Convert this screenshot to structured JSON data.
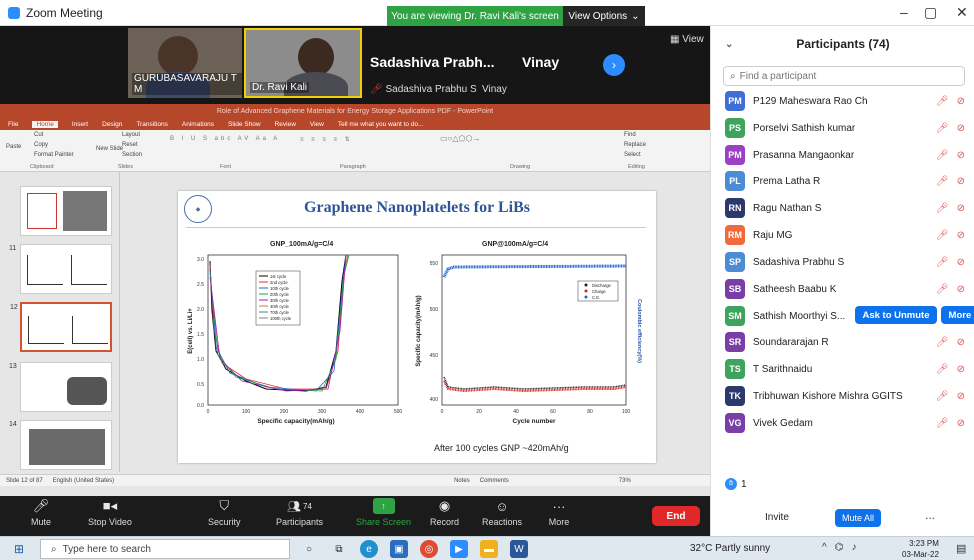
{
  "window": {
    "title": "Zoom Meeting"
  },
  "banner": {
    "viewing": "You are viewing Dr. Ravi Kali's screen",
    "view_options": "View Options"
  },
  "gallery": {
    "tiles": [
      {
        "name": "GURUBASAVARAJU T M"
      },
      {
        "name": "Dr. Ravi Kali"
      }
    ],
    "speaker_name": "Sadashiva  Prabh...",
    "speaker_sub": "Sadashiva Prabhu S",
    "second_name": "Vinay",
    "second_sub": "Vinay",
    "view_label": "View"
  },
  "ppt": {
    "title": "Role of Advanced Graphene Materials for Energy Storage Applications PDF - PowerPoint",
    "tabs": [
      "File",
      "Home",
      "Insert",
      "Design",
      "Transitions",
      "Animations",
      "Slide Show",
      "Review",
      "View",
      "Tell me what you want to do..."
    ],
    "ribbon_groups": [
      "Clipboard",
      "Slides",
      "Font",
      "Paragraph",
      "Drawing",
      "Editing"
    ],
    "clipboard": {
      "cut": "Cut",
      "copy": "Copy",
      "painter": "Format Painter",
      "paste": "Paste"
    },
    "slides": {
      "layout": "Layout",
      "reset": "Reset",
      "section": "Section",
      "new": "New Slide"
    },
    "editing": {
      "find": "Find",
      "replace": "Replace",
      "select": "Select"
    },
    "thumb_numbers": [
      "11",
      "12",
      "13",
      "14"
    ],
    "status": {
      "slide": "Slide 12 of 87",
      "lang": "English (United States)",
      "notes": "Notes",
      "comments": "Comments",
      "zoom": "73%"
    }
  },
  "slide": {
    "title": "Graphene Nanoplatelets for LiBs",
    "left_plot": {
      "title": "GNP_100mA/g=C/4",
      "xlabel": "Specific capacity(mAh/g)",
      "ylabel": "E(cell) vs. Li/Li+",
      "legend": [
        "1st cycle",
        "2nd cycle",
        "10th cycle",
        "20th cycle",
        "30th cycle",
        "40th cycle",
        "70th cycle",
        "100th cycle"
      ],
      "xticks": [
        "0",
        "100",
        "200",
        "300",
        "400",
        "500"
      ],
      "yticks": [
        "3.0",
        "2.5",
        "2.0",
        "1.5",
        "1.0",
        "0.5",
        "0.0"
      ]
    },
    "right_plot": {
      "title": "GNP@100mA/g=C/4",
      "xlabel": "Cycle number",
      "ylabel": "Specific capacity(mAh/g)",
      "ylabel2": "Coulombic efficiency(%)",
      "legend": [
        "Discharge",
        "Charge",
        "C.E."
      ],
      "xticks": [
        "0",
        "20",
        "40",
        "60",
        "80",
        "100"
      ],
      "yticks": [
        "550",
        "500",
        "450",
        "400"
      ]
    },
    "note": "After 100 cycles GNP ~420mAh/g"
  },
  "toolbar": {
    "mute": "Mute",
    "video": "Stop Video",
    "security": "Security",
    "participants": "Participants",
    "participants_count": "74",
    "share": "Share Screen",
    "record": "Record",
    "reactions": "Reactions",
    "more": "More",
    "end": "End"
  },
  "panel": {
    "title": "Participants (74)",
    "search_placeholder": "Find a participant",
    "ask_unmute": "Ask to Unmute",
    "more": "More >",
    "raised": "1",
    "invite": "Invite",
    "mute_all": "Mute All",
    "more_dots": "...",
    "participants": [
      {
        "initials": "PM",
        "name": "P129  Maheswara Rao Ch",
        "color": "#3d6fd6"
      },
      {
        "initials": "PS",
        "name": "Porselvi Sathish kumar",
        "color": "#3da35d"
      },
      {
        "initials": "PM",
        "name": "Prasanna Mangaonkar",
        "color": "#9b3fc4"
      },
      {
        "initials": "PL",
        "name": "Prema Latha R",
        "color": "#4d8bd4"
      },
      {
        "initials": "RN",
        "name": "Ragu Nathan S",
        "color": "#2b3a6b"
      },
      {
        "initials": "RM",
        "name": "Raju MG",
        "color": "#f06a3c"
      },
      {
        "initials": "SP",
        "name": "Sadashiva Prabhu S",
        "color": "#4d8bd4"
      },
      {
        "initials": "SB",
        "name": "Satheesh Baabu K",
        "color": "#7a3fa6"
      },
      {
        "initials": "SM",
        "name": "Sathish Moorthyi S...",
        "color": "#3da35d"
      },
      {
        "initials": "SR",
        "name": "Soundararajan R",
        "color": "#7a3fa6"
      },
      {
        "initials": "TS",
        "name": "T Sarithnaidu",
        "color": "#3da35d"
      },
      {
        "initials": "TK",
        "name": "Tribhuwan Kishore Mishra GGITS",
        "color": "#2b3a6b"
      },
      {
        "initials": "VG",
        "name": "Vivek Gedam",
        "color": "#7a3fa6"
      }
    ]
  },
  "taskbar": {
    "search": "Type here to search",
    "weather": "32°C  Partly sunny",
    "time": "3:23 PM",
    "date": "03-Mar-22"
  }
}
